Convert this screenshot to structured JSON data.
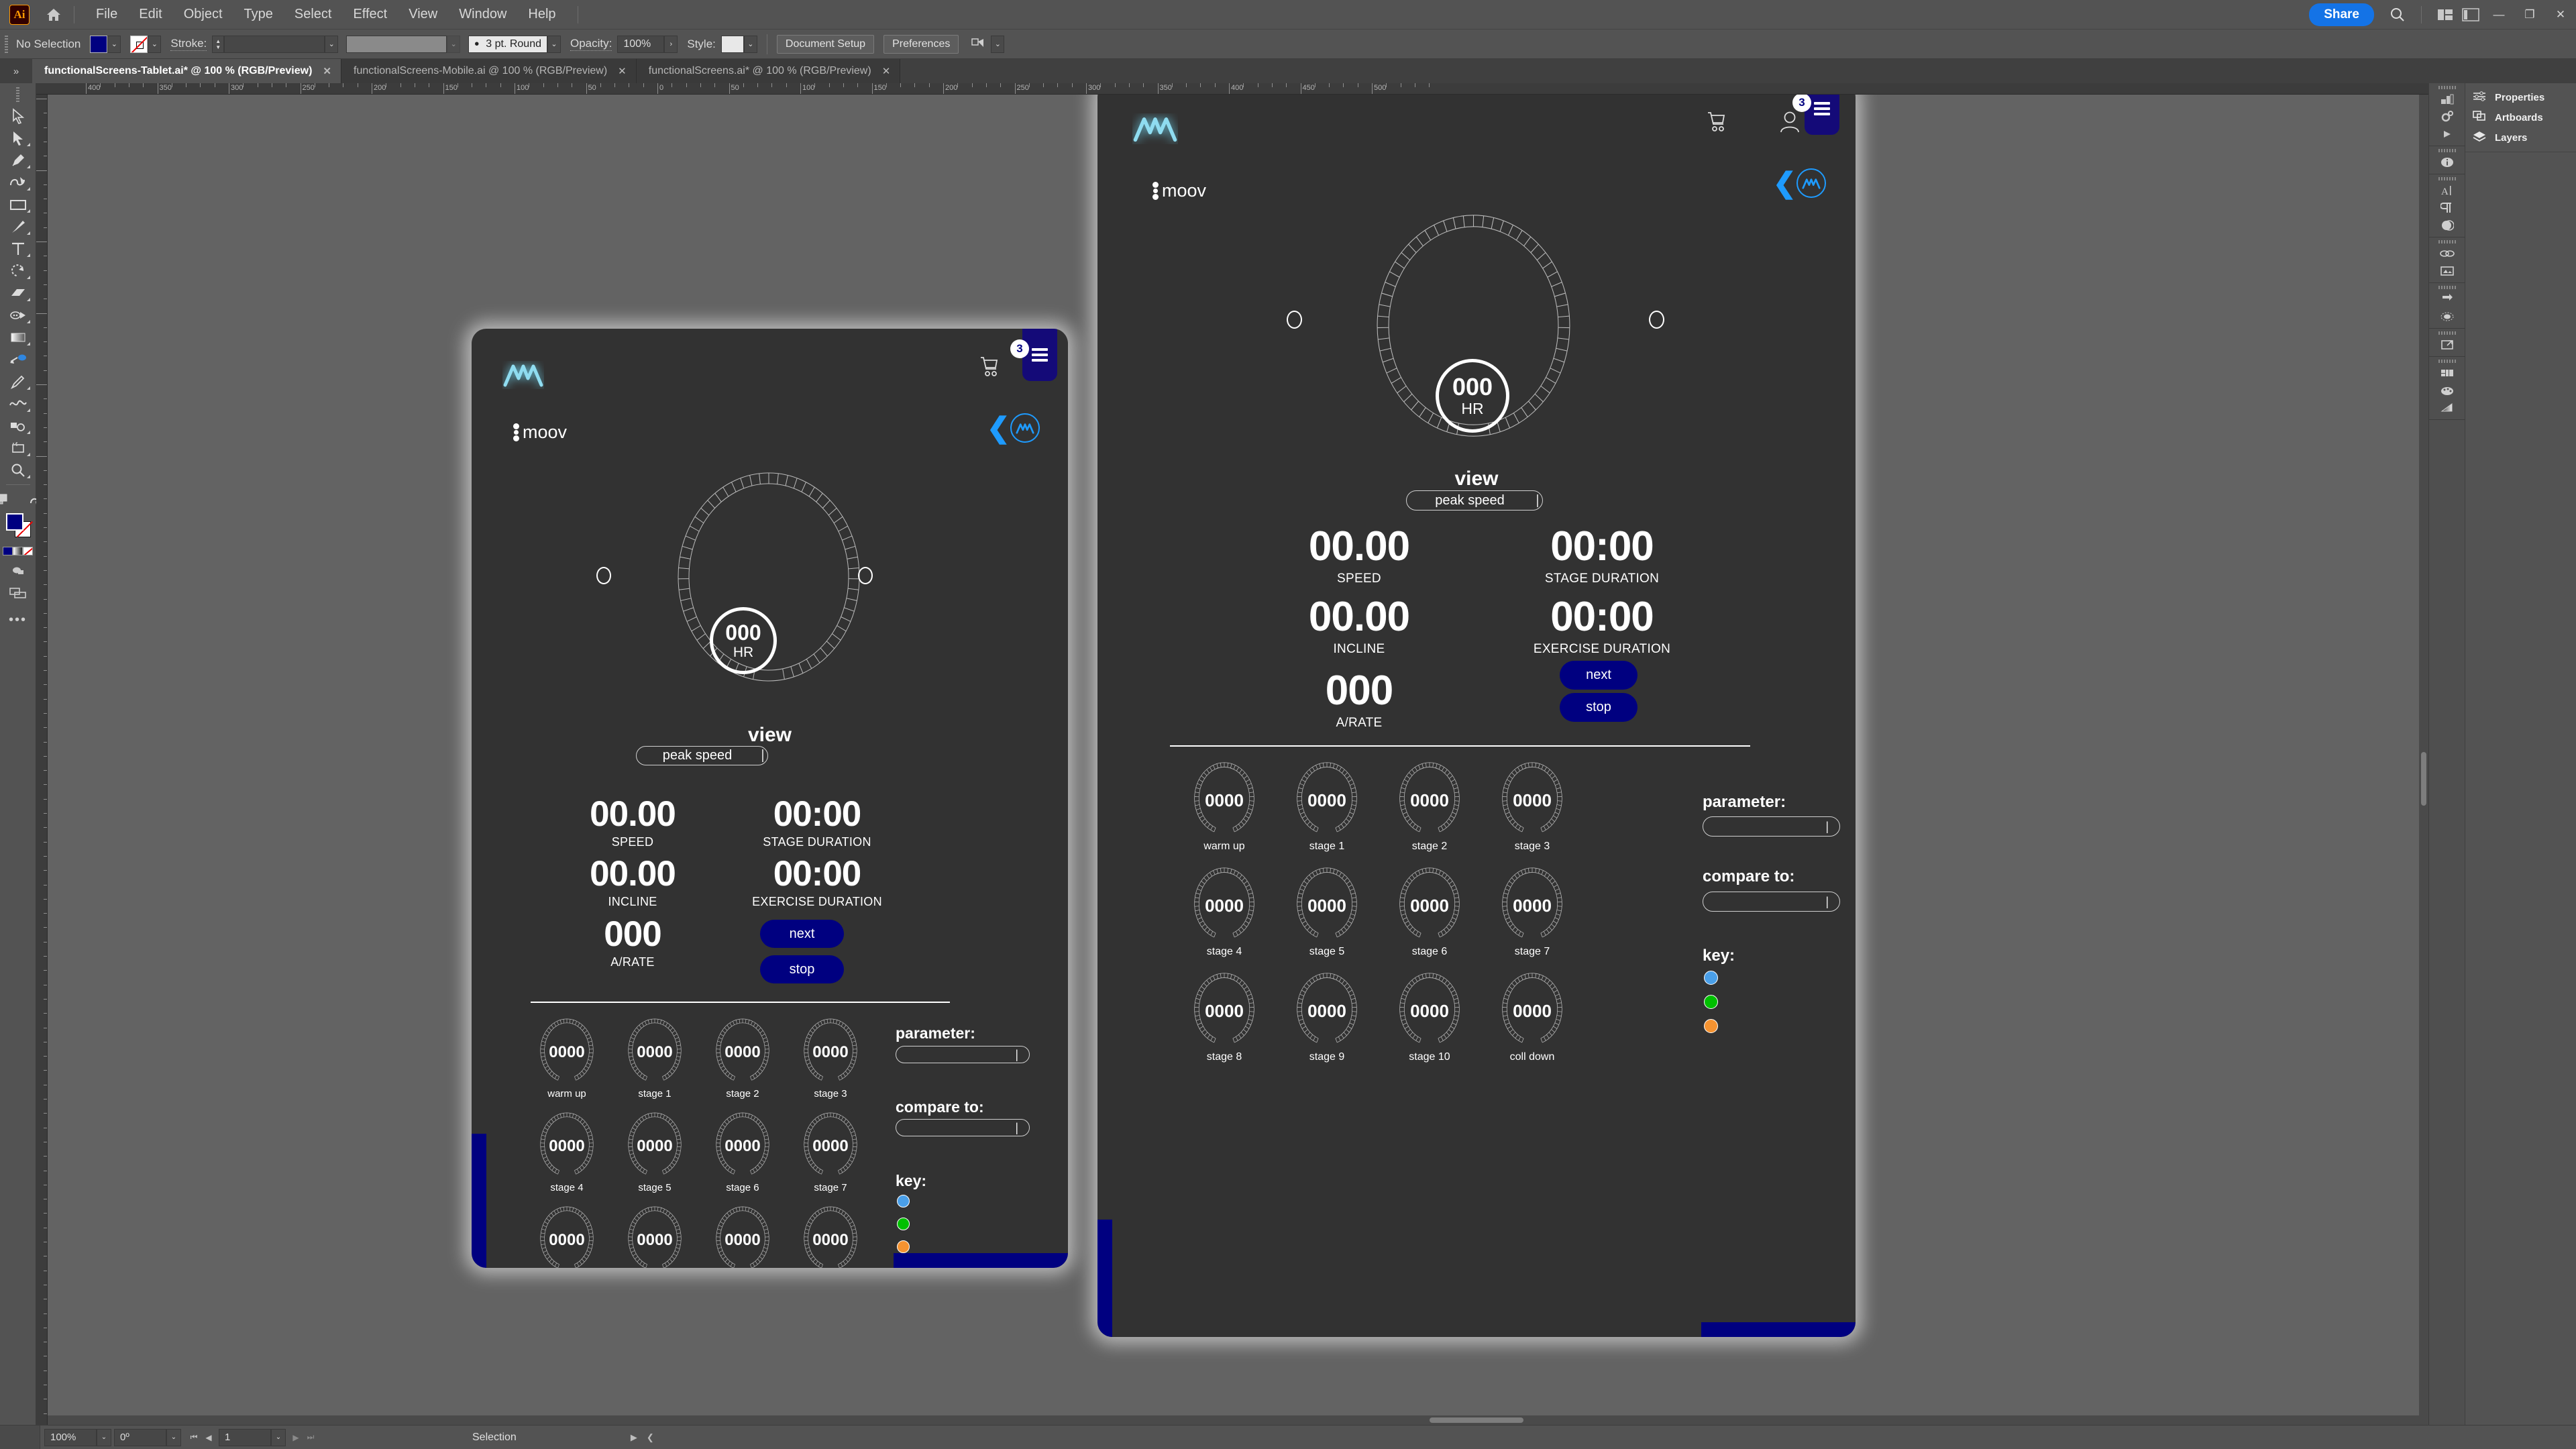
{
  "app": {
    "name": "Ai",
    "menu": [
      "File",
      "Edit",
      "Object",
      "Type",
      "Select",
      "Effect",
      "View",
      "Window",
      "Help"
    ],
    "share_label": "Share",
    "window_controls": {
      "minimize": "—",
      "maximize": "❐",
      "close": "✕"
    }
  },
  "control_bar": {
    "selection_status": "No Selection",
    "fill_color": "#000080",
    "stroke_color": "none",
    "stroke_label": "Stroke:",
    "stroke_weight": "",
    "stroke_profile": "",
    "stroke_style": "3 pt. Round",
    "opacity_label": "Opacity:",
    "opacity_value": "100%",
    "style_label": "Style:",
    "document_setup_label": "Document Setup",
    "preferences_label": "Preferences"
  },
  "tabs": [
    {
      "title": "functionalScreens-Tablet.ai* @ 100 % (RGB/Preview)",
      "active": true
    },
    {
      "title": "functionalScreens-Mobile.ai @ 100 % (RGB/Preview)",
      "active": false
    },
    {
      "title": "functionalScreens.ai* @ 100 % (RGB/Preview)",
      "active": false
    }
  ],
  "toolbar": {
    "tools": [
      "selection-tool",
      "direct-selection-tool",
      "pen-tool",
      "curvature-tool",
      "rectangle-tool",
      "paintbrush-tool",
      "type-tool",
      "rotate-tool",
      "eraser-tool",
      "shape-builder-tool",
      "gradient-tool",
      "free-transform-tool",
      "eyedropper-tool",
      "blend-tool",
      "symbol-sprayer-tool",
      "artboard-tool",
      "zoom-tool"
    ]
  },
  "right_dock": {
    "panels": [
      {
        "label": "Properties",
        "icon": "sliders-icon"
      },
      {
        "label": "Artboards",
        "icon": "artboards-icon"
      },
      {
        "label": "Layers",
        "icon": "layers-icon"
      }
    ],
    "icon_rail": [
      "swatches-icon",
      "gear-icon",
      "play-icon",
      "info-icon",
      "character-icon",
      "paragraph-icon",
      "transparency-icon",
      "links-icon",
      "asset-export-icon",
      "transform-icon",
      "appearance-icon",
      "export-icon",
      "libraries-icon",
      "color-palette-icon",
      "gradient-icon"
    ]
  },
  "status_bar": {
    "zoom": "100%",
    "rotation": "0º",
    "artboard_number": "1",
    "tool_status": "Selection"
  },
  "ruler": {
    "h_labels": [
      "400",
      "350",
      "300",
      "250",
      "200",
      "150",
      "100",
      "50",
      "0",
      "50",
      "100",
      "150",
      "200",
      "250",
      "300",
      "350",
      "400",
      "450",
      "500"
    ],
    "unit_step": 50
  },
  "artboards": [
    {
      "id": "tablet",
      "name": "functionalScreens-Tablet"
    },
    {
      "id": "desktop",
      "name": "functionalScreens"
    }
  ],
  "design": {
    "colors": {
      "background": "#323232",
      "navy": "#000080",
      "accent_blue": "#1e9bff",
      "logo_glow": "#8fdcf0",
      "key_blue": "#4a9fe8",
      "key_green": "#00c000",
      "key_orange": "#f59331"
    },
    "header": {
      "logo": "moov-logo",
      "brand_text": "moov",
      "cart_icon": "shopping-cart-icon",
      "account_icon": "user-account-icon",
      "menu_icon": "hamburger-menu-icon",
      "menu_badge": "3",
      "back_icon": "back-chevron-icon"
    },
    "hr_gauge": {
      "value": "000",
      "unit": "HR"
    },
    "view": {
      "label": "view",
      "selected": "peak speed",
      "caret": "|"
    },
    "metrics": [
      {
        "value": "00.00",
        "label": "SPEED"
      },
      {
        "value": "00:00",
        "label": "STAGE DURATION"
      },
      {
        "value": "00.00",
        "label": "INCLINE"
      },
      {
        "value": "00:00",
        "label": "EXERCISE DURATION"
      },
      {
        "value": "000",
        "label": "A/RATE"
      }
    ],
    "actions": [
      {
        "label": "next"
      },
      {
        "label": "stop"
      }
    ],
    "stages": [
      {
        "value": "0000",
        "name": "warm up"
      },
      {
        "value": "0000",
        "name": "stage 1"
      },
      {
        "value": "0000",
        "name": "stage 2"
      },
      {
        "value": "0000",
        "name": "stage 3"
      },
      {
        "value": "0000",
        "name": "stage 4"
      },
      {
        "value": "0000",
        "name": "stage 5"
      },
      {
        "value": "0000",
        "name": "stage 6"
      },
      {
        "value": "0000",
        "name": "stage 7"
      },
      {
        "value": "0000",
        "name": "stage 8"
      },
      {
        "value": "0000",
        "name": "stage 9"
      },
      {
        "value": "0000",
        "name": "stage 10"
      },
      {
        "value": "0000",
        "name": "coll down"
      }
    ],
    "panel": {
      "parameter_label": "parameter:",
      "parameter_value": "",
      "compare_label": "compare to:",
      "compare_value": "",
      "caret": "|",
      "key_label": "key:",
      "key_colors": [
        "#4a9fe8",
        "#00c000",
        "#f59331"
      ]
    }
  }
}
